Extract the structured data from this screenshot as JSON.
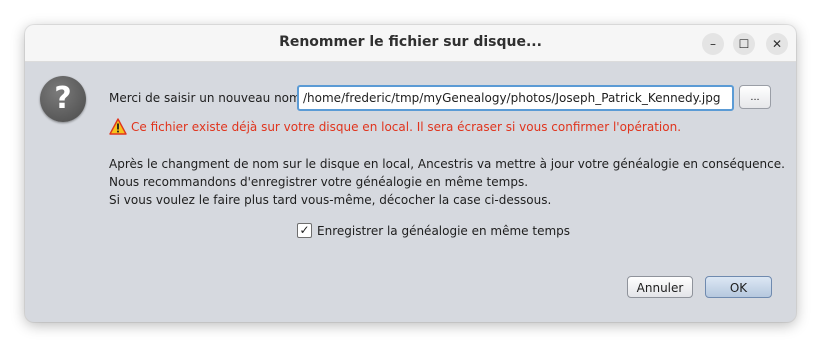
{
  "window": {
    "title": "Renommer le fichier sur disque...",
    "controls": {
      "minimize": "–",
      "maximize": "☐",
      "close": "✕"
    }
  },
  "dialog": {
    "icon": "question-icon",
    "icon_glyph": "?",
    "prompt_label": "Merci de saisir un nouveau nom",
    "path_value": "/home/frederic/tmp/myGenealogy/photos/Joseph_Patrick_Kennedy.jpg",
    "browse_label": "...",
    "warning": {
      "icon": "warning-triangle-icon",
      "text": "Ce fichier existe déjà sur votre disque en local. Il sera écraser si vous confirmer l'opération."
    },
    "info_lines": [
      "Après le changment de nom sur le disque en local, Ancestris va mettre à jour votre généalogie en conséquence.",
      "Nous recommandons d'enregistrer votre généalogie en même temps.",
      "Si vous voulez le faire plus tard vous-même, décocher la case ci-dessous."
    ],
    "checkbox": {
      "checked": true,
      "label": "Enregistrer la généalogie en même temps",
      "mark": "✓"
    },
    "buttons": {
      "cancel": "Annuler",
      "ok": "OK"
    }
  },
  "colors": {
    "dialog_bg": "#d6d9df",
    "warning_text": "#e0341d",
    "focus_border": "#5b9bd5"
  }
}
